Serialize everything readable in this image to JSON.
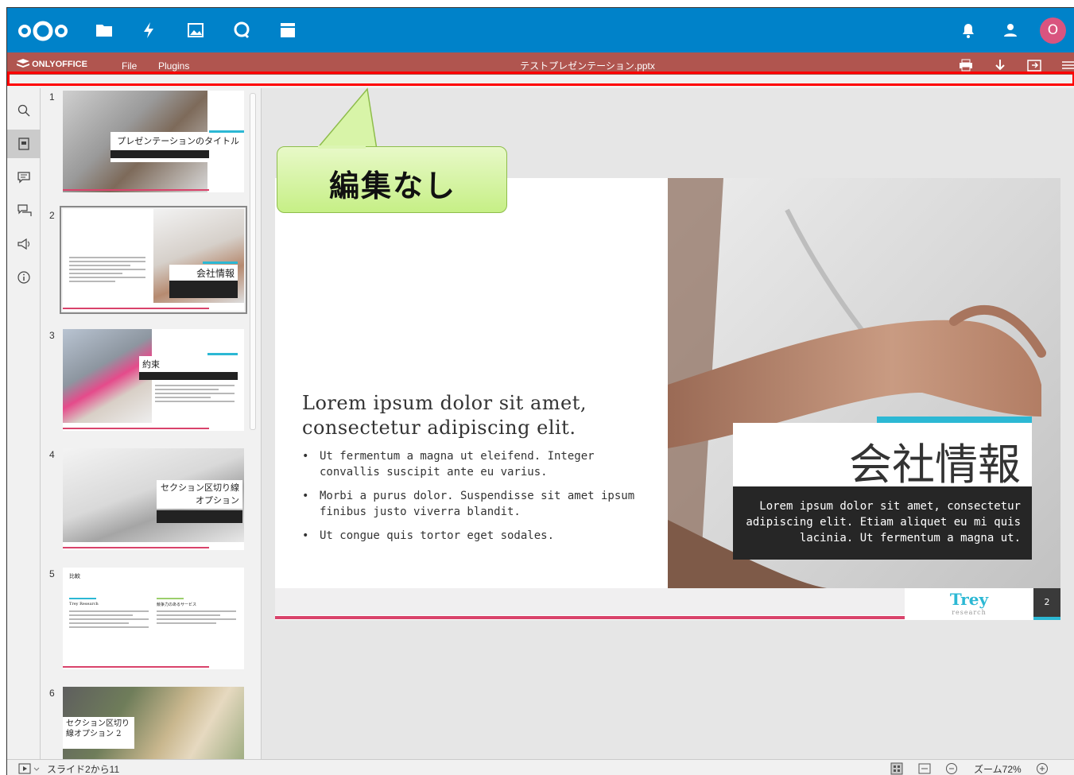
{
  "nextcloud": {
    "apps": [
      "files-icon",
      "activity-icon",
      "gallery-icon",
      "talk-icon",
      "deck-icon"
    ],
    "avatar_letter": "O"
  },
  "editor": {
    "brand": "ONLYOFFICE",
    "menu": [
      "File",
      "Plugins"
    ],
    "document_title": "テストプレゼンテーション.pptx"
  },
  "callout": {
    "text": "編集なし"
  },
  "thumbnails": [
    {
      "number": "1",
      "title": "プレゼンテーションのタイトル"
    },
    {
      "number": "2",
      "title": "会社情報"
    },
    {
      "number": "3",
      "title": "約束"
    },
    {
      "number": "4",
      "title": "セクション区切り線オプション"
    },
    {
      "number": "5",
      "title": "比較",
      "col1": "Trey Research",
      "col2": "競争力のあるサービス"
    },
    {
      "number": "6",
      "title": "セクション区切り線オプション 2"
    }
  ],
  "slide": {
    "body_title": "Lorem ipsum dolor sit amet, consectetur adipiscing elit.",
    "bullets": [
      "Ut fermentum a magna ut eleifend. Integer convallis suscipit ante eu varius.",
      "Morbi a purus dolor. Suspendisse sit amet ipsum finibus justo viverra blandit.",
      "Ut congue quis tortor eget sodales."
    ],
    "big_title": "会社情報",
    "dark_text": "Lorem ipsum dolor sit amet, consectetur adipiscing elit. Etiam aliquet eu mi quis lacinia. Ut fermentum a magna ut.",
    "logo_name": "Trey",
    "logo_sub": "research",
    "page_number": "2"
  },
  "status": {
    "slide_counter": "スライド2から11",
    "zoom": "ズーム72%"
  },
  "colors": {
    "nextcloud_blue": "#0082c9",
    "onlyoffice_red": "#b0554f",
    "accent_cyan": "#2cb8d4",
    "accent_pink": "#d9436b",
    "callout_green": "#c6ef86"
  }
}
